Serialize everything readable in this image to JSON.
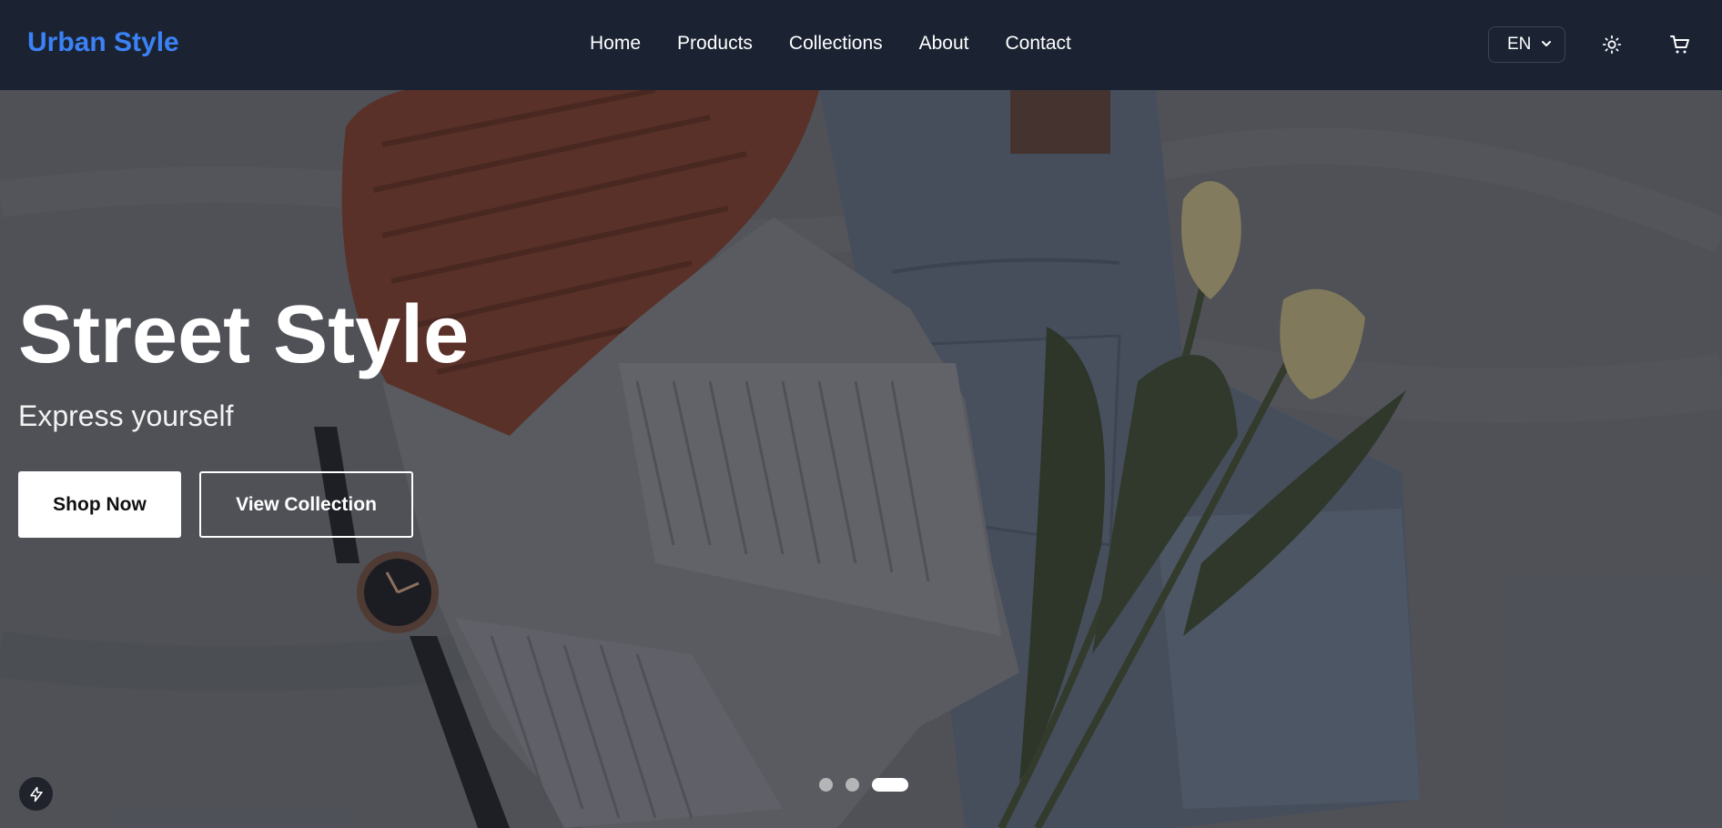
{
  "brand": {
    "name": "Urban Style",
    "color": "#3b82f6"
  },
  "nav": {
    "links": [
      "Home",
      "Products",
      "Collections",
      "About",
      "Contact"
    ]
  },
  "header": {
    "language": "EN",
    "theme_icon": "sun-icon",
    "cart_icon": "cart-icon"
  },
  "hero": {
    "title": "Street Style",
    "subtitle": "Express yourself",
    "primary_button": "Shop Now",
    "secondary_button": "View Collection",
    "slides": {
      "count": 3,
      "active_index": 2
    }
  },
  "floating": {
    "icon": "bolt-icon"
  }
}
